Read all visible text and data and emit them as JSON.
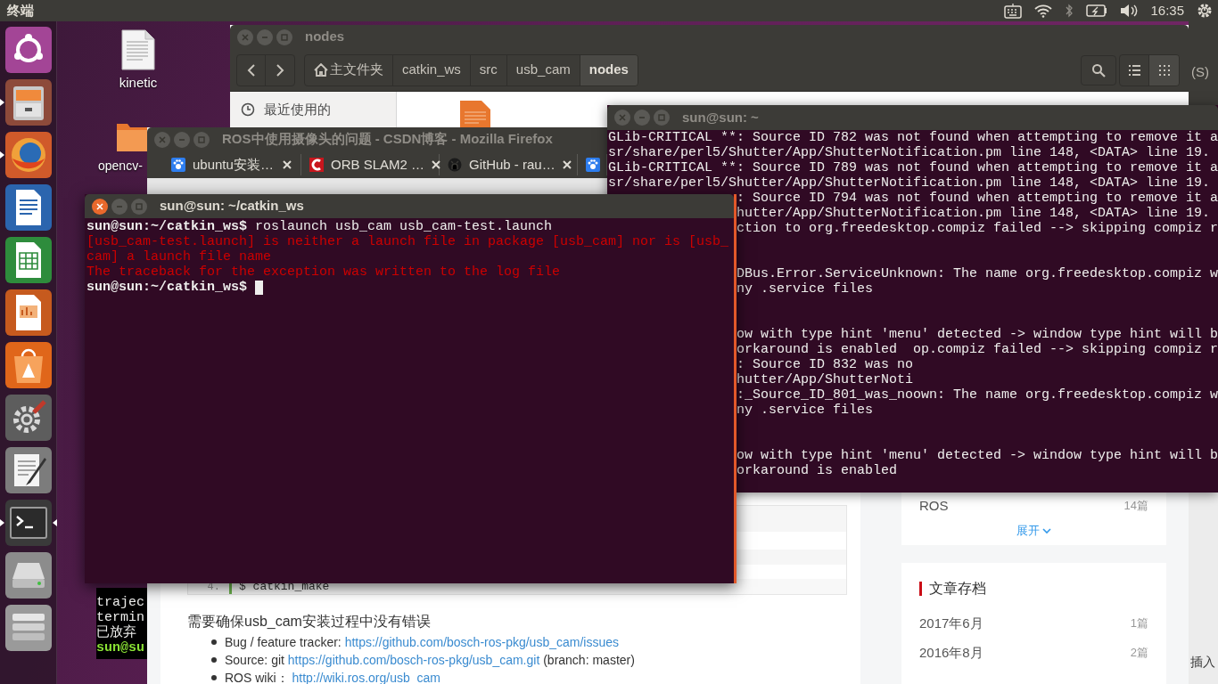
{
  "top_bar": {
    "app_title": "终端",
    "time": "16:35"
  },
  "launcher": [
    {
      "kind": "dash",
      "running": false,
      "focused": false
    },
    {
      "kind": "files",
      "running": true,
      "focused": false
    },
    {
      "kind": "browser",
      "running": true,
      "focused": false
    },
    {
      "kind": "writer",
      "running": false,
      "focused": false
    },
    {
      "kind": "calc",
      "running": false,
      "focused": false
    },
    {
      "kind": "impress",
      "running": false,
      "focused": false
    },
    {
      "kind": "software",
      "running": false,
      "focused": false
    },
    {
      "kind": "settings",
      "running": false,
      "focused": false
    },
    {
      "kind": "editor",
      "running": false,
      "focused": false
    },
    {
      "kind": "terminal",
      "running": true,
      "focused": true
    },
    {
      "kind": "disk",
      "running": false,
      "focused": false
    },
    {
      "kind": "stack",
      "running": false,
      "focused": false
    }
  ],
  "desktop_icons": [
    {
      "kind": "document",
      "label": "kinetic"
    },
    {
      "kind": "folder",
      "label": "opencv-"
    }
  ],
  "back_window_top": {
    "text": "(S)"
  },
  "back_window_bottom": {
    "text": "插入"
  },
  "back_terminal": {
    "lines": [
      {
        "kind": "output",
        "text": "trajec"
      },
      {
        "kind": "output",
        "text": "termin"
      },
      {
        "kind": "output",
        "text": "已放弃"
      },
      {
        "kind": "prompt",
        "text": "sun@su"
      }
    ]
  },
  "file_manager": {
    "title": "nodes",
    "active": false,
    "path": [
      {
        "label": "主文件夹",
        "home": true,
        "selected": false
      },
      {
        "label": "catkin_ws",
        "home": false,
        "selected": false
      },
      {
        "label": "src",
        "home": false,
        "selected": false
      },
      {
        "label": "usb_cam",
        "home": false,
        "selected": false
      },
      {
        "label": "nodes",
        "home": false,
        "selected": true
      }
    ],
    "view_modes": [
      {
        "kind": "list",
        "selected": false
      },
      {
        "kind": "grid",
        "selected": true
      }
    ],
    "sidebar": [
      {
        "label": "最近使用的"
      }
    ]
  },
  "firefox": {
    "title": "ROS中使用摄像头的问题 - CSDN博客 - Mozilla Firefox",
    "active": false,
    "tabs": [
      {
        "label": "ubuntu安装…",
        "kind": "paw"
      },
      {
        "label": "ORB SLAM2 …",
        "kind": "arc"
      },
      {
        "label": "GitHub - rau…",
        "kind": "cat"
      },
      {
        "kind": "paw"
      }
    ],
    "article": {
      "code_line": {
        "number": "4.",
        "code": "$ catkin_make"
      },
      "paragraph": "需要确保usb_cam安装过程中没有错误",
      "bullets": [
        {
          "label": "Bug / feature tracker:",
          "link": "https://github.com/bosch-ros-pkg/usb_cam/issues"
        },
        {
          "label": "Source: git",
          "link": "https://github.com/bosch-ros-pkg/usb_cam.git",
          "suffix": "(branch: master)"
        },
        {
          "label": "ROS wiki：",
          "link": "http://wiki.ros.org/usb_cam"
        }
      ]
    },
    "sidebar": {
      "categories": [
        {
          "label": "ROS",
          "count": "14篇"
        }
      ],
      "expand": "展开",
      "archive": {
        "title": "文章存档",
        "items": [
          {
            "label": "2017年6月",
            "count": "1篇"
          },
          {
            "label": "2016年8月",
            "count": "2篇"
          }
        ]
      }
    }
  },
  "terminal_right": {
    "title": "sun@sun: ~",
    "active": false,
    "lines": [
      {
        "kind": "full",
        "text": "GLib-CRITICAL **: Source ID 782 was not found when attempting to remove it a"
      },
      {
        "kind": "full",
        "text": "sr/share/perl5/Shutter/App/ShutterNotification.pm line 148, <DATA> line 19."
      },
      {
        "kind": "full",
        "text": "GLib-CRITICAL **: Source ID 789 was not found when attempting to remove it a"
      },
      {
        "kind": "full",
        "text": "sr/share/perl5/Shutter/App/ShutterNotification.pm line 148, <DATA> line 19."
      },
      {
        "kind": "partial",
        "text": ": Source ID 794 was not found when attempting to remove it a"
      },
      {
        "kind": "partial",
        "text": "hutter/App/ShutterNotification.pm line 148, <DATA> line 19."
      },
      {
        "kind": "partial",
        "text": "ction to org.freedesktop.compiz failed --> skipping compiz r"
      },
      {
        "kind": "blank"
      },
      {
        "kind": "blank"
      },
      {
        "kind": "partial",
        "text": "DBus.Error.ServiceUnknown: The name org.freedesktop.compiz w"
      },
      {
        "kind": "partial",
        "text": "ny .service files"
      },
      {
        "kind": "blank"
      },
      {
        "kind": "blank"
      },
      {
        "kind": "partial",
        "text": "ow with type hint 'menu' detected -> window type hint will b"
      },
      {
        "kind": "partial",
        "text": "orkaround is enabled  op.compiz failed --> skipping compiz r"
      },
      {
        "kind": "partial",
        "text": ": Source ID 832 was no"
      },
      {
        "kind": "partial",
        "text": "hutter/App/ShutterNoti"
      },
      {
        "kind": "partial",
        "text": ":_Source_ID_801_was_noown: The name org.freedesktop.compiz w"
      },
      {
        "kind": "partial",
        "text": "ny .service files"
      },
      {
        "kind": "blank"
      },
      {
        "kind": "blank"
      },
      {
        "kind": "partial",
        "text": "ow with type hint 'menu' detected -> window type hint will b"
      },
      {
        "kind": "partial",
        "text": "orkaround is enabled"
      }
    ]
  },
  "terminal_left": {
    "title": "sun@sun: ~/catkin_ws",
    "active": true,
    "lines": [
      {
        "kind": "command",
        "text": "**sun@sun:~/catkin_ws$** roslaunch usb_cam usb_cam-test.launch"
      },
      {
        "kind": "error",
        "text": "[usb_cam-test.launch] is neither a launch file in package [usb_cam] nor is [usb_"
      },
      {
        "kind": "error",
        "text": "cam] a launch file name"
      },
      {
        "kind": "error",
        "text": "The traceback for the exception was written to the log file"
      },
      {
        "kind": "prompt",
        "text": "sun@sun:~/catkin_ws$",
        "cursor": true
      }
    ]
  }
}
